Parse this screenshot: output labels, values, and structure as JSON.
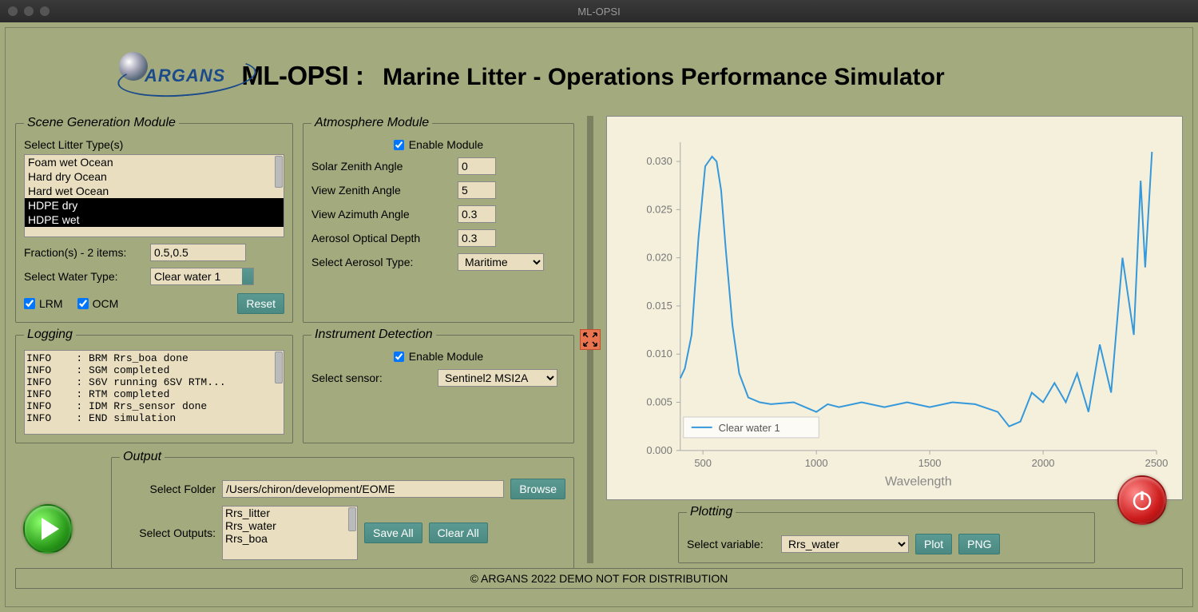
{
  "window": {
    "title": "ML-OPSI"
  },
  "header": {
    "logo_text": "ARGANS",
    "title_prefix": "ML-OPSI :",
    "title_suffix": "Marine Litter - Operations Performance Simulator"
  },
  "scene": {
    "legend": "Scene Generation Module",
    "select_litter_label": "Select Litter Type(s)",
    "litter_options": [
      {
        "label": "Foam wet Ocean",
        "selected": false
      },
      {
        "label": "Hard dry Ocean",
        "selected": false
      },
      {
        "label": "Hard wet Ocean",
        "selected": false
      },
      {
        "label": "HDPE dry",
        "selected": true
      },
      {
        "label": "HDPE wet",
        "selected": true
      }
    ],
    "fractions_label": "Fraction(s) - 2 items:",
    "fractions_value": "0.5,0.5",
    "water_type_label": "Select Water Type:",
    "water_type_value": "Clear water 1",
    "lrm_label": "LRM",
    "lrm_checked": true,
    "ocm_label": "OCM",
    "ocm_checked": true,
    "reset_label": "Reset"
  },
  "atmo": {
    "legend": "Atmosphere Module",
    "enable_label": "Enable Module",
    "enable_checked": true,
    "rows": [
      {
        "label": "Solar Zenith Angle",
        "value": "0"
      },
      {
        "label": "View Zenith Angle",
        "value": "5"
      },
      {
        "label": "View Azimuth Angle",
        "value": "0.3"
      },
      {
        "label": "Aerosol Optical Depth",
        "value": "0.3"
      }
    ],
    "aerosol_label": "Select Aerosol Type:",
    "aerosol_value": "Maritime"
  },
  "logging": {
    "legend": "Logging",
    "lines": [
      "INFO    : BRM Rrs_boa done",
      "INFO    : SGM completed",
      "INFO    : S6V running 6SV RTM...",
      "INFO    : RTM completed",
      "INFO    : IDM Rrs_sensor done",
      "INFO    : END simulation"
    ]
  },
  "instr": {
    "legend": "Instrument Detection",
    "enable_label": "Enable Module",
    "enable_checked": true,
    "sensor_label": "Select sensor:",
    "sensor_value": "Sentinel2 MSI2A"
  },
  "output": {
    "legend": "Output",
    "folder_label": "Select Folder",
    "folder_value": "/Users/chiron/development/EOME",
    "browse_label": "Browse",
    "outputs_label": "Select Outputs:",
    "output_options": [
      "Rrs_litter",
      "Rrs_water",
      "Rrs_boa"
    ],
    "save_label": "Save All",
    "clear_label": "Clear All"
  },
  "plotting": {
    "legend": "Plotting",
    "variable_label": "Select variable:",
    "variable_value": "Rrs_water",
    "plot_label": "Plot",
    "png_label": "PNG"
  },
  "footer": "© ARGANS 2022 DEMO NOT FOR DISTRIBUTION",
  "chart_data": {
    "type": "line",
    "title": "",
    "xlabel": "Wavelength",
    "ylabel": "",
    "xlim": [
      400,
      2500
    ],
    "ylim": [
      0.0,
      0.032
    ],
    "yticks": [
      0.0,
      0.005,
      0.01,
      0.015,
      0.02,
      0.025,
      0.03
    ],
    "xticks": [
      500,
      1000,
      1500,
      2000,
      2500
    ],
    "series": [
      {
        "name": "Clear water 1",
        "color": "#3498db",
        "x": [
          400,
          420,
          450,
          480,
          510,
          540,
          560,
          580,
          600,
          630,
          660,
          700,
          750,
          800,
          900,
          1000,
          1050,
          1100,
          1200,
          1300,
          1400,
          1500,
          1600,
          1700,
          1800,
          1850,
          1900,
          1950,
          2000,
          2050,
          2100,
          2150,
          2200,
          2250,
          2300,
          2350,
          2400,
          2430,
          2450,
          2480
        ],
        "y": [
          0.0075,
          0.0085,
          0.012,
          0.022,
          0.0295,
          0.0305,
          0.03,
          0.027,
          0.021,
          0.013,
          0.008,
          0.0055,
          0.005,
          0.0048,
          0.005,
          0.004,
          0.0048,
          0.0045,
          0.005,
          0.0045,
          0.005,
          0.0045,
          0.005,
          0.0048,
          0.004,
          0.0025,
          0.003,
          0.006,
          0.005,
          0.007,
          0.005,
          0.008,
          0.004,
          0.011,
          0.006,
          0.02,
          0.012,
          0.028,
          0.019,
          0.031
        ]
      }
    ]
  }
}
